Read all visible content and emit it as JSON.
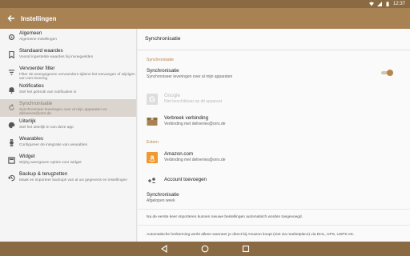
{
  "status_bar": {
    "time": "12:37"
  },
  "app_bar": {
    "title": "Instellingen"
  },
  "sidebar": {
    "items": [
      {
        "label": "Algemeen",
        "sub": "Algemene instellingen",
        "icon": "gear-icon"
      },
      {
        "label": "Standaard waardes",
        "sub": "Vooraf ingestelde waardes bij invoegvelden",
        "icon": "bookmark-icon"
      },
      {
        "label": "Vervoerder filter",
        "sub": "Filter de weergegeven vervoerders tijdens het toevoegen of wijzigen van een levering",
        "icon": "filter-icon"
      },
      {
        "label": "Notificaties",
        "sub": "Stel het gebruik van notificaties in",
        "icon": "bell-icon"
      },
      {
        "label": "Synchronisatie",
        "sub": "Synchroniseer leveringen over al mijn apparaten en deliveries@orrs.de",
        "icon": "sync-icon"
      },
      {
        "label": "Uiterlijk",
        "sub": "Stel het uiterlijk in van deze app",
        "icon": "palette-icon"
      },
      {
        "label": "Wearables",
        "sub": "Configureer de integratie van wearables",
        "icon": "watch-icon"
      },
      {
        "label": "Widget",
        "sub": "Wijzig weergaven opties voor widget",
        "icon": "widget-icon"
      },
      {
        "label": "Backup & terugzetten",
        "sub": "Maak en importeer backups van al uw gegevens en instellingen",
        "icon": "restore-icon"
      }
    ]
  },
  "content": {
    "title": "Synchronisatie",
    "section_sync": "Synchronisatie",
    "sync_toggle": {
      "title": "Synchronisatie",
      "sub": "Synchroniseer leveringen over al mijn apparaten",
      "on": true
    },
    "google": {
      "title": "Google",
      "sub": "Niet beschikbaar op dit apparaat"
    },
    "disconnect": {
      "title": "Verbreek verbinding",
      "sub": "Verbinding met deliveries@orrs.de"
    },
    "section_extern": "Extern",
    "amazon": {
      "title": "Amazon.com",
      "sub": "Verbinding met deliveries@orrs.de"
    },
    "add_account": {
      "title": "Account toevoegen"
    },
    "sync_freq": {
      "title": "Synchronisatie",
      "sub": "Afgelopen week"
    },
    "note1": "Na de eerste keer importeren kunnen nieuwe bestellingen automatisch worden toegevoegd.",
    "note2": "Automatische herkenning werkt alleen wanneer je direct bij Amazon koopt (niet via marketplace) via DHL, UPS, USPS etc."
  },
  "colors": {
    "accent": "#b6844e",
    "appbar": "#a98254",
    "statusbar": "#8a6a43"
  }
}
